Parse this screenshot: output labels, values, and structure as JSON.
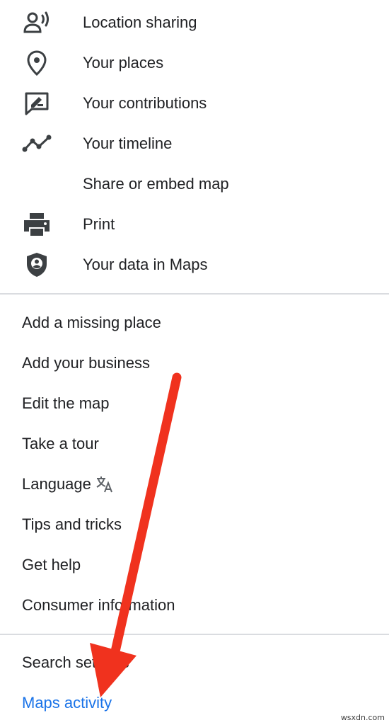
{
  "menu_primary": [
    {
      "label": "Location sharing",
      "icon": "location-sharing-icon"
    },
    {
      "label": "Your places",
      "icon": "place-pin-icon"
    },
    {
      "label": "Your contributions",
      "icon": "contributions-icon"
    },
    {
      "label": "Your timeline",
      "icon": "timeline-icon"
    },
    {
      "label": "Share or embed map",
      "icon": ""
    },
    {
      "label": "Print",
      "icon": "printer-icon"
    },
    {
      "label": "Your data in Maps",
      "icon": "data-shield-icon"
    }
  ],
  "menu_secondary": [
    {
      "label": "Add a missing place"
    },
    {
      "label": "Add your business"
    },
    {
      "label": "Edit the map"
    },
    {
      "label": "Take a tour"
    },
    {
      "label": "Language",
      "icon": "translate-icon"
    },
    {
      "label": "Tips and tricks"
    },
    {
      "label": "Get help"
    },
    {
      "label": "Consumer information"
    }
  ],
  "menu_footer": [
    {
      "label": "Search settings"
    },
    {
      "label": "Maps activity",
      "highlighted": true
    }
  ],
  "colors": {
    "text": "#202124",
    "icon": "#3c4043",
    "link": "#1a73e8",
    "divider": "#dadce0",
    "annotation_arrow": "#f0321e"
  },
  "annotation": {
    "type": "arrow",
    "points_to": "Maps activity"
  },
  "watermark": "wsxdn.com"
}
